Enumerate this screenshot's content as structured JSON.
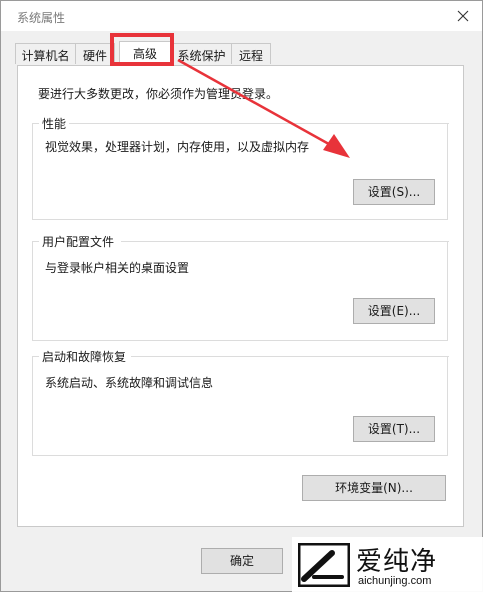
{
  "window": {
    "title": "系统属性"
  },
  "tabs": [
    {
      "label": "计算机名",
      "active": false
    },
    {
      "label": "硬件",
      "active": false
    },
    {
      "label": "高级",
      "active": true
    },
    {
      "label": "系统保护",
      "active": false
    },
    {
      "label": "远程",
      "active": false
    }
  ],
  "panel": {
    "admin_note": "要进行大多数更改，你必须作为管理员登录。"
  },
  "groups": {
    "performance": {
      "title": "性能",
      "description": "视觉效果，处理器计划，内存使用，以及虚拟内存",
      "button": "设置(S)..."
    },
    "user_profiles": {
      "title": "用户配置文件",
      "description": "与登录帐户相关的桌面设置",
      "button": "设置(E)..."
    },
    "startup_recovery": {
      "title": "启动和故障恢复",
      "description": "系统启动、系统故障和调试信息",
      "button": "设置(T)..."
    }
  },
  "env_button": "环境变量(N)...",
  "footer": {
    "ok": "确定"
  },
  "annotation": {
    "color": "#e8333a"
  },
  "watermark": {
    "name": "爱纯净",
    "url": "aichunjing.com"
  }
}
